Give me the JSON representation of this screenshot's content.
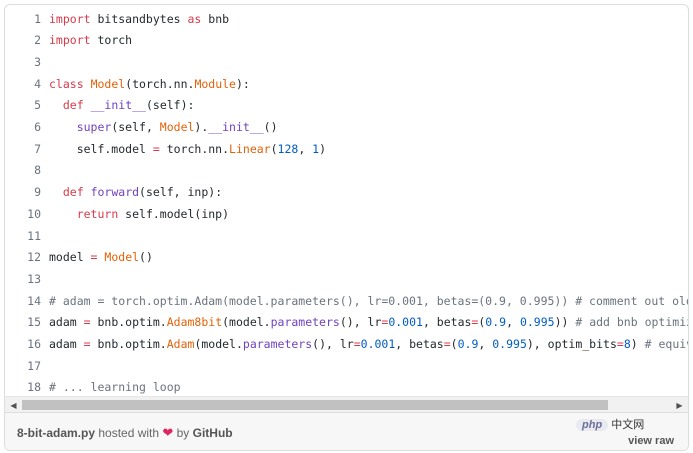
{
  "lines": [
    {
      "n": "1",
      "tokens": [
        {
          "t": "import",
          "c": "kw"
        },
        {
          "t": " bitsandbytes ",
          "c": ""
        },
        {
          "t": "as",
          "c": "kw"
        },
        {
          "t": " bnb",
          "c": ""
        }
      ]
    },
    {
      "n": "2",
      "tokens": [
        {
          "t": "import",
          "c": "kw"
        },
        {
          "t": " torch",
          "c": ""
        }
      ]
    },
    {
      "n": "3",
      "tokens": []
    },
    {
      "n": "4",
      "tokens": [
        {
          "t": "class",
          "c": "kw"
        },
        {
          "t": " ",
          "c": ""
        },
        {
          "t": "Model",
          "c": "cls"
        },
        {
          "t": "(torch.nn.",
          "c": ""
        },
        {
          "t": "Module",
          "c": "cls"
        },
        {
          "t": "):",
          "c": ""
        }
      ]
    },
    {
      "n": "5",
      "tokens": [
        {
          "t": "  ",
          "c": ""
        },
        {
          "t": "def",
          "c": "kw"
        },
        {
          "t": " ",
          "c": ""
        },
        {
          "t": "__init__",
          "c": "fn"
        },
        {
          "t": "(self):",
          "c": ""
        }
      ]
    },
    {
      "n": "6",
      "tokens": [
        {
          "t": "    ",
          "c": ""
        },
        {
          "t": "super",
          "c": "fn"
        },
        {
          "t": "(self, ",
          "c": ""
        },
        {
          "t": "Model",
          "c": "cls"
        },
        {
          "t": ").",
          "c": ""
        },
        {
          "t": "__init__",
          "c": "fn"
        },
        {
          "t": "()",
          "c": ""
        }
      ]
    },
    {
      "n": "7",
      "tokens": [
        {
          "t": "    self.model ",
          "c": ""
        },
        {
          "t": "=",
          "c": "kw"
        },
        {
          "t": " torch.nn.",
          "c": ""
        },
        {
          "t": "Linear",
          "c": "cls"
        },
        {
          "t": "(",
          "c": ""
        },
        {
          "t": "128",
          "c": "num"
        },
        {
          "t": ", ",
          "c": ""
        },
        {
          "t": "1",
          "c": "num"
        },
        {
          "t": ")",
          "c": ""
        }
      ]
    },
    {
      "n": "8",
      "tokens": []
    },
    {
      "n": "9",
      "tokens": [
        {
          "t": "  ",
          "c": ""
        },
        {
          "t": "def",
          "c": "kw"
        },
        {
          "t": " ",
          "c": ""
        },
        {
          "t": "forward",
          "c": "fn"
        },
        {
          "t": "(self, inp):",
          "c": ""
        }
      ]
    },
    {
      "n": "10",
      "tokens": [
        {
          "t": "    ",
          "c": ""
        },
        {
          "t": "return",
          "c": "kw"
        },
        {
          "t": " self.model(inp)",
          "c": ""
        }
      ]
    },
    {
      "n": "11",
      "tokens": []
    },
    {
      "n": "12",
      "tokens": [
        {
          "t": "model ",
          "c": ""
        },
        {
          "t": "=",
          "c": "kw"
        },
        {
          "t": " ",
          "c": ""
        },
        {
          "t": "Model",
          "c": "cls"
        },
        {
          "t": "()",
          "c": ""
        }
      ]
    },
    {
      "n": "13",
      "tokens": []
    },
    {
      "n": "14",
      "tokens": [
        {
          "t": "# adam = torch.optim.Adam(model.parameters(), lr=0.001, betas=(0.9, 0.995)) # comment out old optimizer",
          "c": "cm"
        }
      ]
    },
    {
      "n": "15",
      "tokens": [
        {
          "t": "adam ",
          "c": ""
        },
        {
          "t": "=",
          "c": "kw"
        },
        {
          "t": " bnb.optim.",
          "c": ""
        },
        {
          "t": "Adam8bit",
          "c": "cls"
        },
        {
          "t": "(model.",
          "c": ""
        },
        {
          "t": "parameters",
          "c": "fn"
        },
        {
          "t": "(), lr",
          "c": ""
        },
        {
          "t": "=",
          "c": "kw"
        },
        {
          "t": "0.001",
          "c": "num"
        },
        {
          "t": ", betas",
          "c": ""
        },
        {
          "t": "=",
          "c": "kw"
        },
        {
          "t": "(",
          "c": ""
        },
        {
          "t": "0.9",
          "c": "num"
        },
        {
          "t": ", ",
          "c": ""
        },
        {
          "t": "0.995",
          "c": "num"
        },
        {
          "t": ")) ",
          "c": ""
        },
        {
          "t": "# add bnb optimizer",
          "c": "cm"
        }
      ]
    },
    {
      "n": "16",
      "tokens": [
        {
          "t": "adam ",
          "c": ""
        },
        {
          "t": "=",
          "c": "kw"
        },
        {
          "t": " bnb.optim.",
          "c": ""
        },
        {
          "t": "Adam",
          "c": "cls"
        },
        {
          "t": "(model.",
          "c": ""
        },
        {
          "t": "parameters",
          "c": "fn"
        },
        {
          "t": "(), lr",
          "c": ""
        },
        {
          "t": "=",
          "c": "kw"
        },
        {
          "t": "0.001",
          "c": "num"
        },
        {
          "t": ", betas",
          "c": ""
        },
        {
          "t": "=",
          "c": "kw"
        },
        {
          "t": "(",
          "c": ""
        },
        {
          "t": "0.9",
          "c": "num"
        },
        {
          "t": ", ",
          "c": ""
        },
        {
          "t": "0.995",
          "c": "num"
        },
        {
          "t": "), optim_bits",
          "c": ""
        },
        {
          "t": "=",
          "c": "kw"
        },
        {
          "t": "8",
          "c": "num"
        },
        {
          "t": ") ",
          "c": ""
        },
        {
          "t": "# equivalent",
          "c": "cm"
        }
      ]
    },
    {
      "n": "17",
      "tokens": []
    },
    {
      "n": "18",
      "tokens": [
        {
          "t": "# ... learning loop",
          "c": "cm"
        }
      ]
    }
  ],
  "footer": {
    "filename": "8-bit-adam.py",
    "hosted_with": " hosted with ",
    "by": " by ",
    "github": "GitHub",
    "view_raw": "view raw"
  },
  "watermark": {
    "php": "php",
    "site": "中文网"
  },
  "icons": {
    "heart": "heart-icon",
    "scroll_left": "chevron-left-icon",
    "scroll_right": "chevron-right-icon"
  },
  "colors": {
    "keyword": "#d73a49",
    "function": "#6f42c1",
    "class": "#e36209",
    "number": "#005cc5",
    "comment": "#6a737d",
    "heart": "#e0245e"
  }
}
